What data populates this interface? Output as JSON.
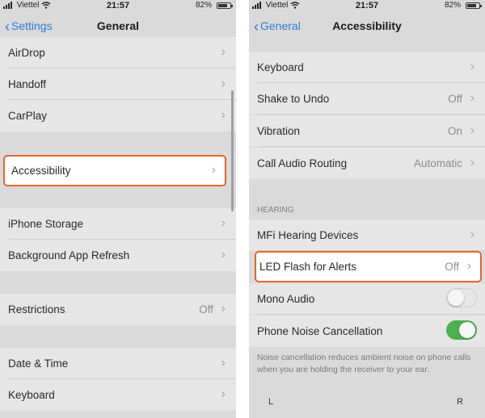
{
  "left": {
    "status": {
      "carrier": "Viettel",
      "time": "21:57",
      "battery": "82%",
      "battery_level": 0.82
    },
    "nav": {
      "back_label": "Settings",
      "title": "General"
    },
    "rows": [
      {
        "label": "AirDrop"
      },
      {
        "label": "Handoff"
      },
      {
        "label": "CarPlay"
      },
      {
        "label": "Accessibility",
        "highlighted": true
      },
      {
        "label": "iPhone Storage"
      },
      {
        "label": "Background App Refresh"
      },
      {
        "label": "Restrictions",
        "value": "Off"
      },
      {
        "label": "Date & Time"
      },
      {
        "label": "Keyboard"
      }
    ]
  },
  "right": {
    "status": {
      "carrier": "Viettel",
      "time": "21:57",
      "battery": "82%",
      "battery_level": 0.82
    },
    "nav": {
      "back_label": "General",
      "title": "Accessibility"
    },
    "rows": [
      {
        "label": "Keyboard"
      },
      {
        "label": "Shake to Undo",
        "value": "Off"
      },
      {
        "label": "Vibration",
        "value": "On"
      },
      {
        "label": "Call Audio Routing",
        "value": "Automatic"
      },
      {
        "label": "MFi Hearing Devices"
      },
      {
        "label": "LED Flash for Alerts",
        "value": "Off",
        "highlighted": true
      },
      {
        "label": "Mono Audio",
        "toggle": "off"
      },
      {
        "label": "Phone Noise Cancellation",
        "toggle": "on"
      }
    ],
    "section_header": "HEARING",
    "footer": "Noise cancellation reduces ambient noise on phone calls when you are holding the receiver to your ear.",
    "balance": {
      "left": "L",
      "right": "R"
    }
  },
  "colors": {
    "accent": "#2f7ad8",
    "highlight_border": "#e5652e",
    "toggle_on": "#4caf50"
  },
  "icons": [
    "signal-bars-icon",
    "wifi-icon",
    "battery-icon",
    "chevron-left-icon",
    "chevron-right-icon"
  ]
}
